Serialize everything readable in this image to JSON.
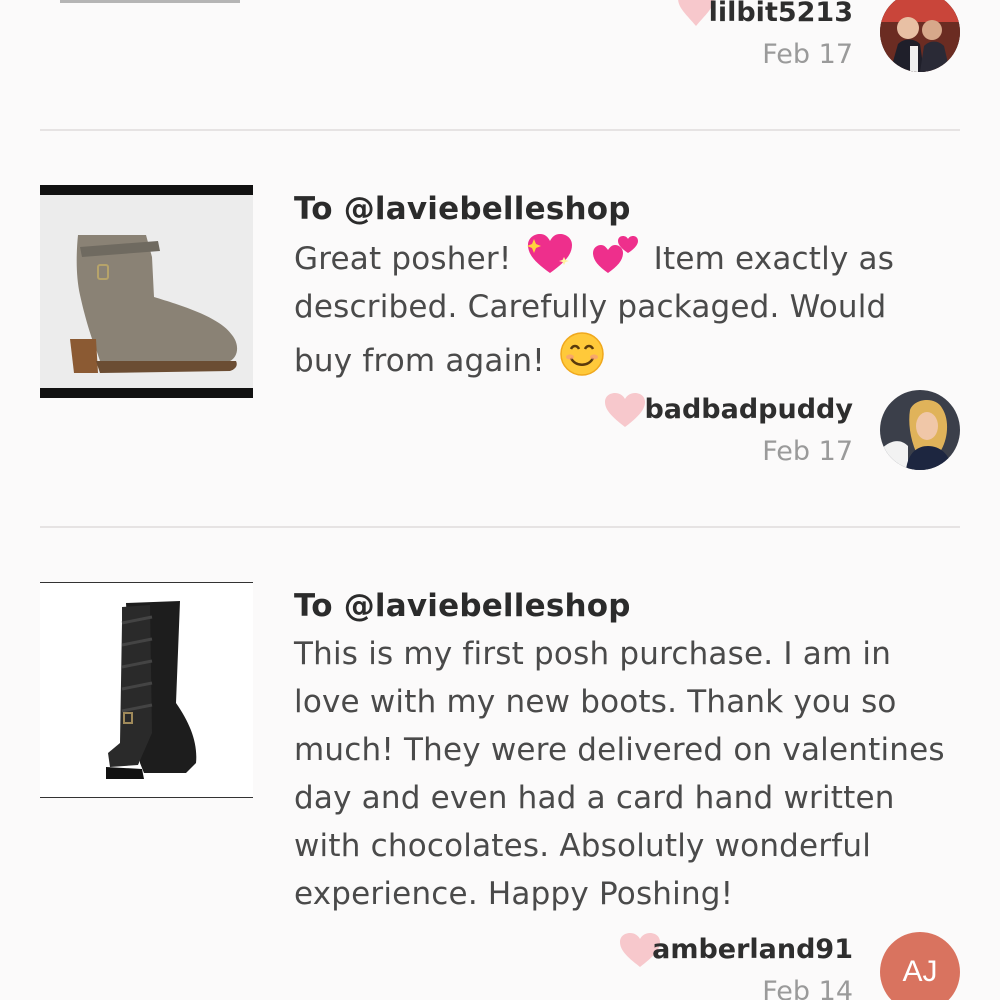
{
  "review_top": {
    "username": "lilbit5213",
    "date": "Feb 17"
  },
  "reviews": [
    {
      "to": "To @laviebelleshop",
      "text_before_emoji": "Great posher!",
      "text_after_emoji": "Item exactly as described. Carefully packaged. Would buy from again!",
      "username": "badbadpuddy",
      "date": "Feb 17",
      "product_icon": "ankle-boot",
      "emoji": [
        "sparkling-heart-icon",
        "two-hearts-icon",
        "smiling-face-icon"
      ]
    },
    {
      "to": "To @laviebelleshop",
      "text": "This is my first posh purchase. I am in love with my new boots. Thank you so much! They were delivered on valentines day and even had a card hand written with chocolates. Absolutly wonderful experience. Happy Poshing!",
      "username": "amberland91",
      "date": "Feb 14",
      "avatar_initials": "AJ",
      "product_icon": "tall-riding-boot"
    }
  ],
  "colors": {
    "heart": "#f7c8cc",
    "avatar_bg": "#d9735f",
    "divider": "#e6e3e3"
  }
}
